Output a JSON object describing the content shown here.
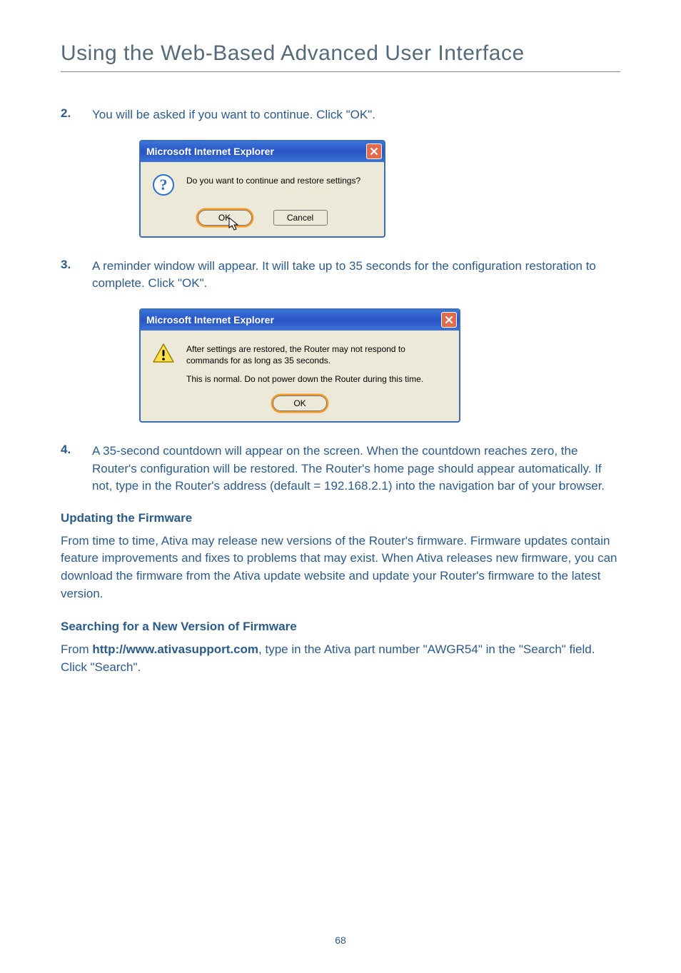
{
  "page": {
    "title": "Using the Web-Based Advanced User Interface",
    "number": "68"
  },
  "steps": {
    "s2": {
      "num": "2.",
      "text": "You will be asked if you want to continue. Click \"OK\"."
    },
    "s3": {
      "num": "3.",
      "text": "A reminder window will appear. It will take up to 35 seconds for the configuration restoration to complete. Click \"OK\"."
    },
    "s4": {
      "num": "4.",
      "text": "A 35-second countdown will appear on the screen. When the countdown reaches zero, the Router's configuration will be restored. The Router's home page should appear automatically. If not, type in the Router's address (default = 192.168.2.1) into the navigation bar of your browser."
    }
  },
  "dialog1": {
    "title": "Microsoft Internet Explorer",
    "message": "Do you want to continue and restore settings?",
    "ok": "OK",
    "cancel": "Cancel"
  },
  "dialog2": {
    "title": "Microsoft Internet Explorer",
    "line1": "After settings are restored, the Router may not respond to commands for as long as 35 seconds.",
    "line2": "This is normal. Do not power down the Router during this time.",
    "ok": "OK"
  },
  "sections": {
    "update_heading": "Updating the Firmware",
    "update_body": "From time to time, Ativa may release new versions of the Router's firmware. Firmware updates contain feature improvements and fixes to problems that may exist. When Ativa releases new firmware, you can download the firmware from the Ativa update website and update your Router's firmware to the latest version.",
    "search_heading": "Searching for a New Version of Firmware",
    "search_prefix": "From ",
    "search_link": "http://www.ativasupport.com",
    "search_suffix": ", type in the Ativa part number \"AWGR54\" in the \"Search\" field. Click \"Search\"."
  }
}
